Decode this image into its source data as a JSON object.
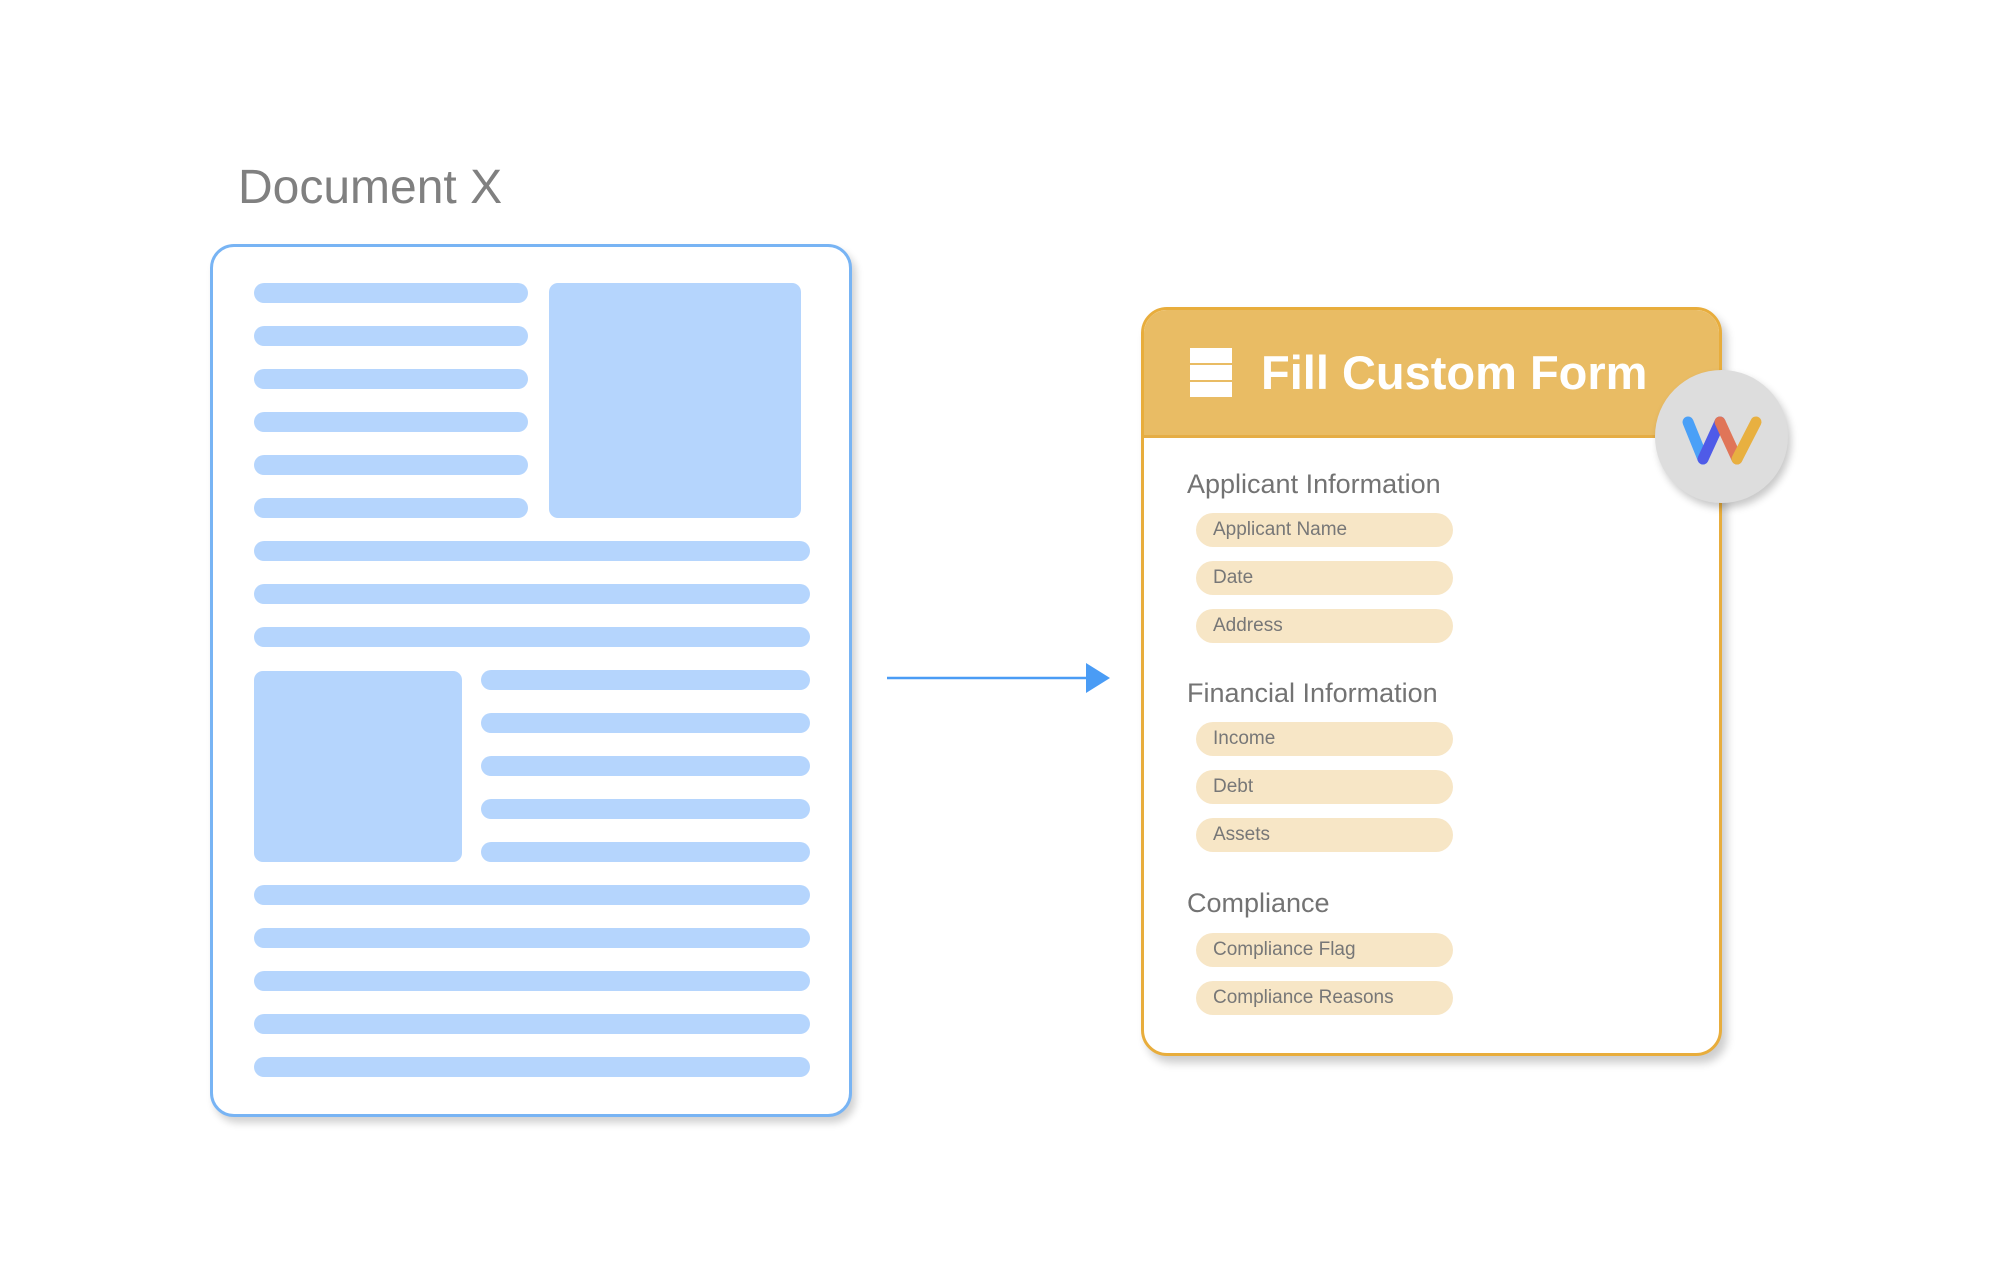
{
  "document": {
    "title": "Document X",
    "colors": {
      "border": "#78b4f4",
      "placeholder": "#b5d5fd"
    }
  },
  "arrow": {
    "color": "#4a9cf5"
  },
  "form": {
    "title": "Fill Custom Form",
    "icon": "form-list-icon",
    "colors": {
      "header": "#e9bc64",
      "border": "#e8ad3c",
      "field": "#f7e6c6"
    },
    "sections": [
      {
        "heading": "Applicant Information",
        "fields": [
          "Applicant Name",
          "Date",
          "Address"
        ]
      },
      {
        "heading": "Financial Information",
        "fields": [
          "Income",
          "Debt",
          "Assets"
        ]
      },
      {
        "heading": "Compliance",
        "fields": [
          "Compliance Flag",
          "Compliance Reasons"
        ]
      }
    ]
  },
  "badge": {
    "icon": "w-logo-icon",
    "colors": [
      "#4aa0f7",
      "#4f5be8",
      "#e07558",
      "#e8b040"
    ]
  }
}
